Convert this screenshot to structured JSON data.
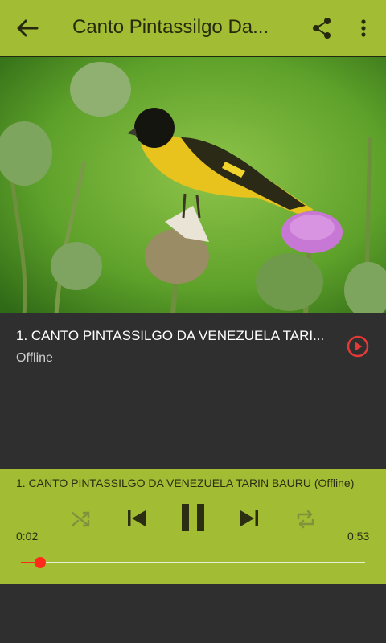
{
  "appbar": {
    "title": "Canto Pintassilgo Da...",
    "icons": {
      "back": "arrow-back-icon",
      "share": "share-icon",
      "more": "more-vert-icon"
    },
    "color": "#a2bd33"
  },
  "track": {
    "name": "1. CANTO PINTASSILGO DA VENEZUELA TARI...",
    "status": "Offline",
    "play_icon": "play-circle-icon",
    "accent": "#e53935"
  },
  "player": {
    "now_playing": "1. CANTO PINTASSILGO DA VENEZUELA TARIN BAURU (Offline)",
    "current_time": "0:02",
    "total_time": "0:53",
    "progress": 0.055,
    "controls": [
      "shuffle-icon",
      "skip-previous-icon",
      "pause-icon",
      "skip-next-icon",
      "repeat-icon"
    ]
  }
}
